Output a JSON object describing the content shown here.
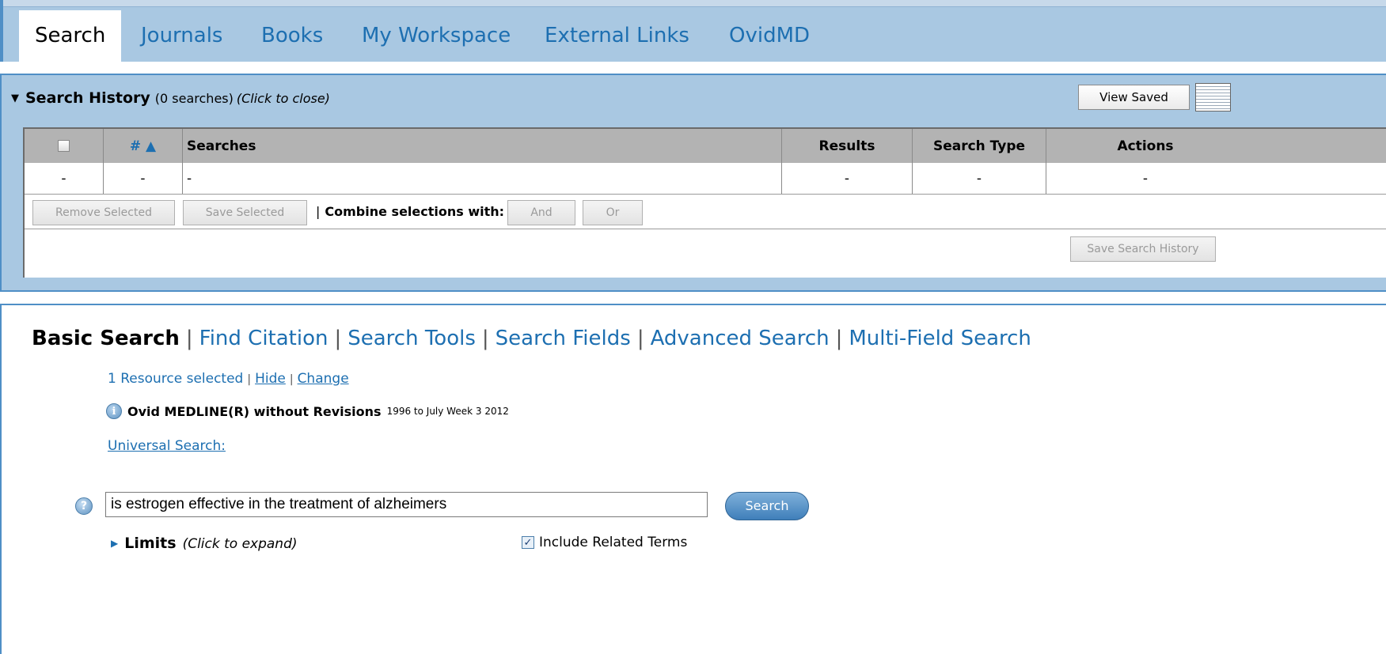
{
  "tabs": [
    {
      "label": "Search"
    },
    {
      "label": "Journals"
    },
    {
      "label": "Books"
    },
    {
      "label": "My Workspace"
    },
    {
      "label": "External Links"
    },
    {
      "label": "OvidMD"
    }
  ],
  "history": {
    "title": "Search History",
    "count": "(0 searches)",
    "hint": "(Click to close)",
    "view_saved": "View Saved",
    "columns": {
      "num": "# ▲",
      "searches": "Searches",
      "results": "Results",
      "search_type": "Search Type",
      "actions": "Actions"
    },
    "row": {
      "checkbox": "-",
      "num": "-",
      "searches": "-",
      "results": "-",
      "search_type": "-",
      "actions": "-"
    },
    "remove_selected": "Remove Selected",
    "save_selected": "Save Selected",
    "separator": "|",
    "combine_label": "Combine selections with:",
    "and_label": "And",
    "or_label": "Or",
    "save_history": "Save Search History"
  },
  "modes": [
    {
      "label": "Basic Search"
    },
    {
      "label": "Find Citation"
    },
    {
      "label": "Search Tools"
    },
    {
      "label": "Search Fields"
    },
    {
      "label": "Advanced Search"
    },
    {
      "label": "Multi-Field Search"
    }
  ],
  "mode_separator": "|",
  "resources": {
    "selected": "1 Resource selected",
    "separator": "|",
    "hide": "Hide",
    "change": "Change",
    "info_glyph": "i",
    "database": "Ovid MEDLINE(R) without Revisions",
    "range": "1996 to July Week 3 2012",
    "universal": "Universal Search:"
  },
  "search": {
    "help_glyph": "?",
    "query": "is estrogen effective in the treatment of alzheimers",
    "button": "Search",
    "limits_arrow": "▶",
    "limits_label": "Limits",
    "limits_hint": "(Click to expand)",
    "related_check": "✓",
    "related_label": "Include Related Terms"
  },
  "icons": {
    "history_toggle": "triangle-down-icon",
    "grid": "grid-view-icon",
    "info": "info-icon",
    "help": "help-icon"
  },
  "colors": {
    "link": "#1d6fb1",
    "tab_bar": "#a9c8e2",
    "panel_border": "#4f8fc6",
    "table_header": "#b3b3b3"
  }
}
